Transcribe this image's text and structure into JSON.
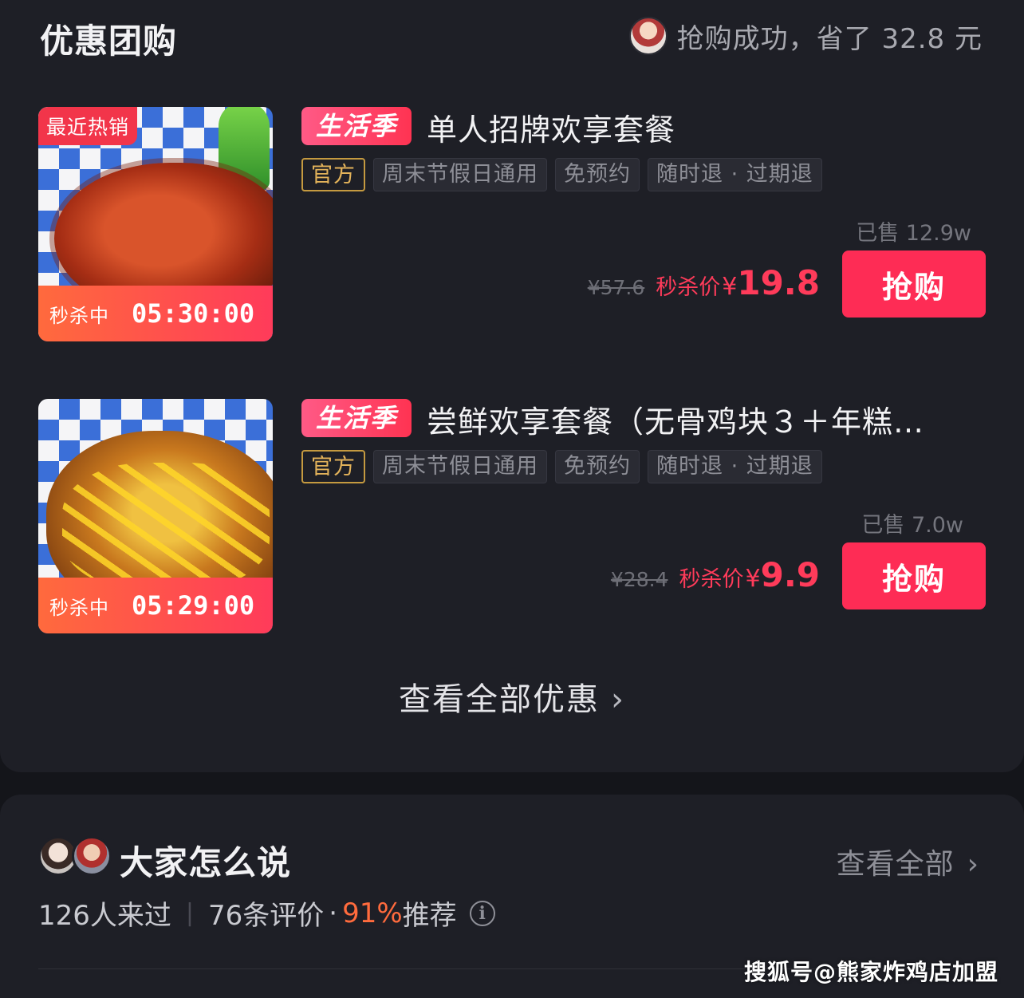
{
  "deals_section": {
    "title": "优惠团购",
    "success_text": "抢购成功，省了 32.8 元",
    "view_all": "查看全部优惠",
    "deals": [
      {
        "hot_tag": "最近热销",
        "flash_label": "秒杀中",
        "countdown": "05:30:00",
        "season_tag": "生活季",
        "title": "单人招牌欢享套餐",
        "chips": [
          "官方",
          "周末节假日通用",
          "免预约",
          "随时退 · 过期退"
        ],
        "sold": "已售 12.9w",
        "original_price": "¥57.6",
        "flash_price_label": "秒杀价",
        "currency": "¥",
        "price": "19.8",
        "buy_label": "抢购"
      },
      {
        "hot_tag": "",
        "flash_label": "秒杀中",
        "countdown": "05:29:00",
        "season_tag": "生活季",
        "title": "尝鲜欢享套餐（无骨鸡块３＋年糕…",
        "chips": [
          "官方",
          "周末节假日通用",
          "免预约",
          "随时退 · 过期退"
        ],
        "sold": "已售 7.0w",
        "original_price": "¥28.4",
        "flash_price_label": "秒杀价",
        "currency": "¥",
        "price": "9.9",
        "buy_label": "抢购"
      }
    ]
  },
  "reviews_section": {
    "title": "大家怎么说",
    "view_all": "查看全部",
    "visitors": "126人来过",
    "reviews": "76条评价",
    "dot": "·",
    "recommend_pct": "91%",
    "recommend_label": "推荐",
    "info_icon": "i"
  },
  "watermark": "搜狐号@熊家炸鸡店加盟",
  "colors": {
    "background": "#14151a",
    "card": "#1e1f26",
    "accent_red": "#fe2c55",
    "price_red": "#ff3b5a",
    "official_gold": "#e2b25a",
    "recommend_orange": "#ff6b3d"
  }
}
